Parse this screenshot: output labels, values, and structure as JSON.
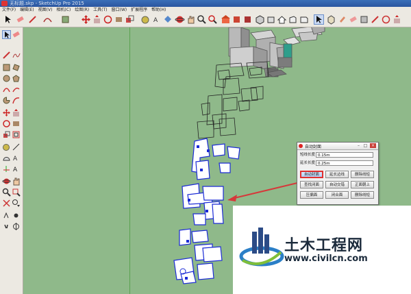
{
  "window": {
    "title": "无标题.skp - SketchUp Pro 2015"
  },
  "menu": [
    "文件(F)",
    "编辑(E)",
    "视图(V)",
    "相机(C)",
    "绘图(R)",
    "工具(T)",
    "窗口(W)",
    "扩展程序",
    "帮助(H)"
  ],
  "dialog": {
    "title": "自动封面",
    "fields": [
      {
        "label": "短线长度",
        "value": "0.15m"
      },
      {
        "label": "延长长度",
        "value": "0.25m"
      }
    ],
    "buttons": [
      [
        "自动封面",
        "延长边线",
        "删除线短"
      ],
      [
        "查找闭面",
        "自动交错",
        "正面朝上"
      ],
      [
        "压偏面",
        "闭合面",
        "删除线短"
      ]
    ]
  },
  "watermark": {
    "name": "土木工程网",
    "url": "www.civilcn.com"
  },
  "colors": {
    "viewport_bg": "#8fb98a",
    "accent": "#e03030",
    "arrow": "#d6383a"
  }
}
